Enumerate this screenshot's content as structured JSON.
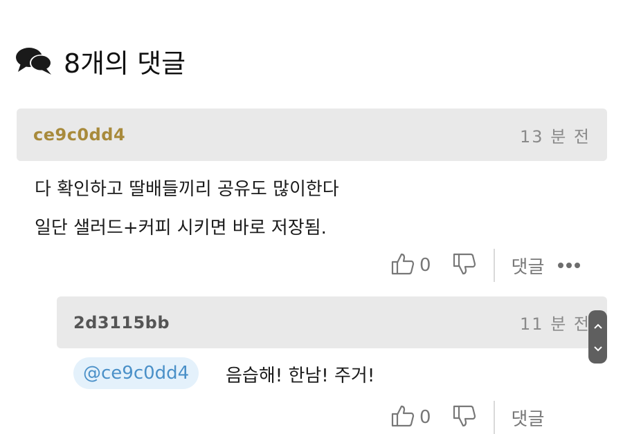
{
  "header": {
    "title": "8개의 댓글",
    "icon": "comments-icon"
  },
  "comments": [
    {
      "author": "ce9c0dd4",
      "time": "13 분 전",
      "lines": [
        "다 확인하고 딸배들끼리 공유도 많이한다",
        "일단 샐러드+커피 시키면 바로 저장됨."
      ],
      "likes": "0",
      "reply_label": "댓글"
    },
    {
      "author": "2d3115bb",
      "time": "11 분 전",
      "mention": "@ce9c0dd4",
      "text": "음습해! 한남! 주거!",
      "likes": "0",
      "reply_label": "댓글"
    }
  ],
  "colors": {
    "author_gold": "#a88a3b",
    "mention_blue": "#4a90c8",
    "bar_gray": "#e9e9e9"
  }
}
